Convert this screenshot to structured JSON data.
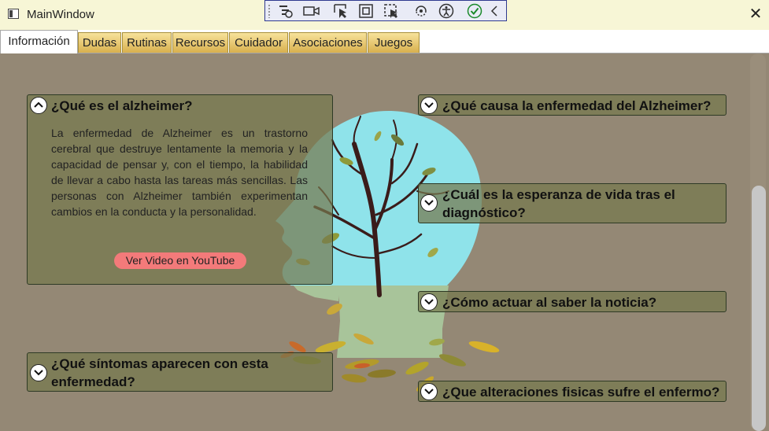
{
  "window": {
    "title": "MainWindow",
    "close_glyph": "✕"
  },
  "devtools": {
    "tools": [
      "select-element-icon",
      "display-layout-adorners-icon",
      "track-focused-element-icon",
      "hot-reload-icon",
      "accessibility-checker-icon",
      "binding-failures-icon",
      "collapse-toolbar-icon"
    ]
  },
  "tabs": [
    "Información",
    "Dudas",
    "Rutinas",
    "Recursos",
    "Cuidador",
    "Asociaciones",
    "Juegos"
  ],
  "active_tab": "Información",
  "panels": {
    "alzheimer": {
      "title": "¿Qué es el alzheimer?",
      "body": "La enfermedad de Alzheimer es un trastorno cerebral que destruye lentamente la memoria y la capacidad de pensar y, con el tiempo, la habilidad de llevar a cabo hasta las tareas más sencillas. Las personas con Alzheimer también experimentan cambios en la conducta y la personalidad.",
      "video_label": "Ver Video en YouTube"
    },
    "sintomas": {
      "title_line1": "¿Qué síntomas aparecen con esta",
      "title_line2": "enfermedad?"
    },
    "causa": {
      "title": "¿Qué causa la enfermedad del Alzheimer?"
    },
    "esperanza": {
      "title_line1": "¿Cuál es la esperanza de vida tras el",
      "title_line2": "diagnóstico?"
    },
    "actuar": {
      "title": "¿Cómo actuar al saber la noticia?"
    },
    "alteraciones": {
      "title": "¿Que alteraciones fisicas sufre el enfermo?"
    }
  },
  "colors": {
    "background": "#948875",
    "panel": "#767850",
    "accent_tab": "#e8c86a",
    "video_button": "#f37a7a",
    "head": "#8fe3ea"
  }
}
